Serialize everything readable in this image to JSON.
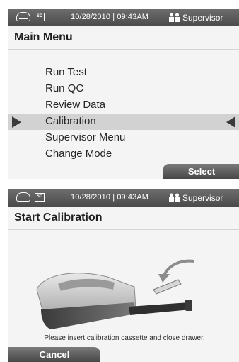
{
  "colors": {
    "statusbar": "#565656",
    "button": "#5a5a5a",
    "highlight": "#d2d2d2",
    "screen_bg": "#f4f4f4"
  },
  "screen1": {
    "status": {
      "drive_icon": "drive-icon",
      "sd_label": "SD",
      "datetime": "10/28/2010 | 09:43AM",
      "user_icon": "supervisor-icon",
      "role": "Supervisor"
    },
    "title": "Main Menu",
    "menu_items": [
      {
        "label": "Run Test",
        "selected": false
      },
      {
        "label": "Run QC",
        "selected": false
      },
      {
        "label": "Review Data",
        "selected": false
      },
      {
        "label": "Calibration",
        "selected": true
      },
      {
        "label": "Supervisor Menu",
        "selected": false
      },
      {
        "label": "Change Mode",
        "selected": false
      }
    ],
    "select_label": "Select"
  },
  "screen2": {
    "status": {
      "drive_icon": "drive-icon",
      "sd_label": "SD",
      "datetime": "10/28/2010 | 09:43AM",
      "user_icon": "supervisor-icon",
      "role": "Supervisor"
    },
    "title": "Start Calibration",
    "illustration": "analyzer-insert-cassette-illustration",
    "instruction": "Please insert calibration cassette and close drawer.",
    "cancel_label": "Cancel"
  }
}
